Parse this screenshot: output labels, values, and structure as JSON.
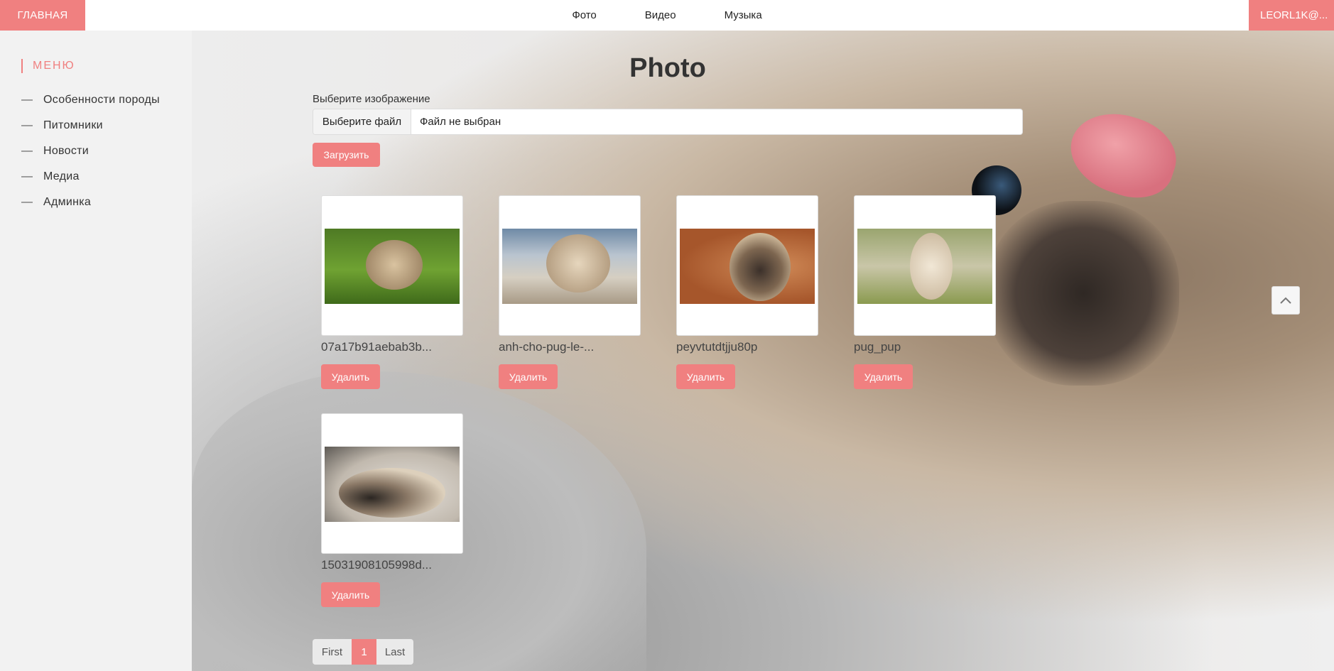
{
  "topbar": {
    "home_label": "ГЛАВНАЯ",
    "nav": [
      "Фото",
      "Видео",
      "Музыка"
    ],
    "user_label": "LEORL1K@..."
  },
  "sidebar": {
    "title": "МЕНЮ",
    "items": [
      {
        "label": "Особенности породы"
      },
      {
        "label": "Питомники"
      },
      {
        "label": "Новости"
      },
      {
        "label": "Медиа"
      },
      {
        "label": "Админка"
      }
    ]
  },
  "main": {
    "title": "Photo",
    "file_label": "Выберите изображение",
    "file_button": "Выберите файл",
    "file_status": "Файл не выбран",
    "upload_label": "Загрузить",
    "delete_label": "Удалить",
    "photos": [
      {
        "name": "07a17b91aebab3b..."
      },
      {
        "name": "anh-cho-pug-le-..."
      },
      {
        "name": "peyvtutdtjju80p"
      },
      {
        "name": "pug_pup"
      },
      {
        "name": "15031908105998d..."
      }
    ]
  },
  "pagination": {
    "first": "First",
    "current": "1",
    "last": "Last"
  },
  "colors": {
    "accent": "#f08080"
  }
}
